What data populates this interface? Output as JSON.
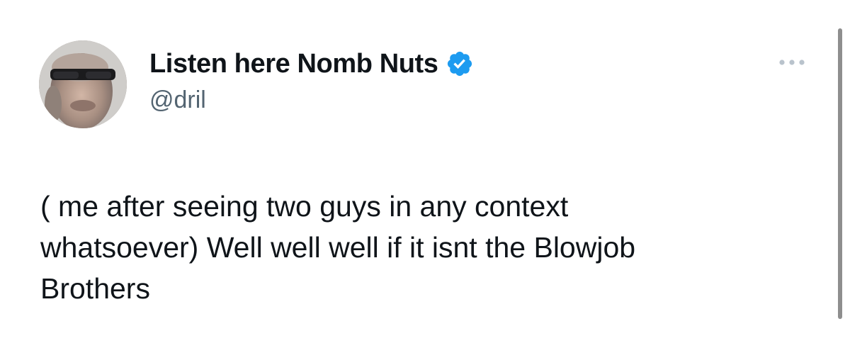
{
  "author": {
    "display_name": "Listen here Nomb Nuts",
    "handle": "@dril",
    "verified": true,
    "avatar_icon": "avatar-photo",
    "verified_icon": "verified-badge-icon"
  },
  "tweet": {
    "text": "( me after seeing two guys in any context\nwhatsoever) Well well well if it isnt the Blowjob\nBrothers"
  },
  "controls": {
    "more_icon": "more-options-icon"
  },
  "colors": {
    "text_primary": "#0f1419",
    "text_secondary": "#536471",
    "verified_blue": "#1d9bf0",
    "more_dots": "#b9c3cc",
    "scrollbar": "#8e8e8e",
    "background": "#ffffff"
  }
}
